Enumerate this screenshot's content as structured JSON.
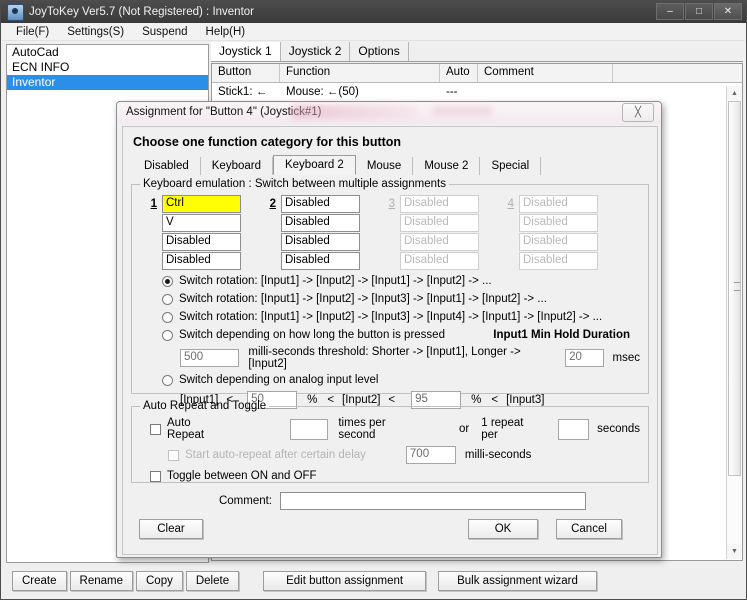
{
  "window": {
    "title": "JoyToKey Ver5.7 (Not Registered) : Inventor",
    "icon": "joystick-icon",
    "controls": {
      "minimize": "–",
      "maximize": "□",
      "close": "✕"
    }
  },
  "menubar": {
    "items": [
      "File(F)",
      "Settings(S)",
      "Suspend",
      "Help(H)"
    ]
  },
  "profiles": {
    "items": [
      {
        "label": "AutoCad",
        "selected": false
      },
      {
        "label": "ECN INFO",
        "selected": false
      },
      {
        "label": "Inventor",
        "selected": true
      }
    ]
  },
  "joystick_panel": {
    "tabs": [
      {
        "label": "Joystick 1",
        "active": true
      },
      {
        "label": "Joystick 2",
        "active": false
      },
      {
        "label": "Options",
        "active": false
      }
    ],
    "columns": [
      "Button",
      "Function",
      "Auto",
      "Comment"
    ],
    "rows": [
      {
        "button": "Stick1: ←",
        "function": "Mouse: ←(50)",
        "auto": "---",
        "comment": ""
      }
    ],
    "scrollbar": {
      "up": "▲",
      "down": "▼"
    }
  },
  "bottom_toolbar": {
    "buttons": [
      "Create",
      "Rename",
      "Copy",
      "Delete"
    ],
    "actions": [
      "Edit button assignment",
      "Bulk assignment wizard"
    ]
  },
  "dialog": {
    "title": "Assignment for \"Button 4\" (Joystick#1)",
    "close_glyph": "╳",
    "heading": "Choose one function category for this button",
    "category_tabs": [
      {
        "label": "Disabled",
        "active": false
      },
      {
        "label": "Keyboard",
        "active": false
      },
      {
        "label": "Keyboard 2",
        "active": true
      },
      {
        "label": "Mouse",
        "active": false
      },
      {
        "label": "Mouse 2",
        "active": false
      },
      {
        "label": "Special",
        "active": false
      }
    ],
    "keyboard_group": {
      "legend": "Keyboard emulation : Switch between multiple assignments",
      "columns": [
        {
          "number": "1",
          "enabled": true,
          "fields": [
            {
              "value": "Ctrl",
              "highlight": true
            },
            {
              "value": "V",
              "highlight": false
            },
            {
              "value": "Disabled",
              "highlight": false
            },
            {
              "value": "Disabled",
              "highlight": false
            }
          ]
        },
        {
          "number": "2",
          "enabled": true,
          "fields": [
            {
              "value": "Disabled",
              "highlight": false
            },
            {
              "value": "Disabled",
              "highlight": false
            },
            {
              "value": "Disabled",
              "highlight": false
            },
            {
              "value": "Disabled",
              "highlight": false
            }
          ]
        },
        {
          "number": "3",
          "enabled": false,
          "fields": [
            {
              "value": "Disabled",
              "highlight": false
            },
            {
              "value": "Disabled",
              "highlight": false
            },
            {
              "value": "Disabled",
              "highlight": false
            },
            {
              "value": "Disabled",
              "highlight": false
            }
          ]
        },
        {
          "number": "4",
          "enabled": false,
          "fields": [
            {
              "value": "Disabled",
              "highlight": false
            },
            {
              "value": "Disabled",
              "highlight": false
            },
            {
              "value": "Disabled",
              "highlight": false
            },
            {
              "value": "Disabled",
              "highlight": false
            }
          ]
        }
      ],
      "radios": [
        {
          "label": "Switch rotation: [Input1] -> [Input2] -> [Input1] -> [Input2] -> ...",
          "checked": true
        },
        {
          "label": "Switch rotation: [Input1] -> [Input2] -> [Input3] -> [Input1] -> [Input2] -> ...",
          "checked": false
        },
        {
          "label": "Switch rotation: [Input1] -> [Input2] -> [Input3] -> [Input4] -> [Input1] -> [Input2] -> ...",
          "checked": false
        },
        {
          "label": "Switch depending on how long the button is pressed",
          "checked": false
        },
        {
          "label": "Switch depending on analog input level",
          "checked": false
        }
      ],
      "hold_duration_label": "Input1 Min Hold Duration",
      "threshold_value": "500",
      "threshold_text": "milli-seconds threshold: Shorter -> [Input1], Longer -> [Input2]",
      "hold_value": "20",
      "hold_unit": "msec",
      "analog": {
        "input1_label": "[Input1]",
        "lt1": "<",
        "value1": "50",
        "pct1": "%",
        "lt2": "<",
        "input2_label": "[Input2]",
        "lt3": "<",
        "value2": "95",
        "pct2": "%",
        "lt4": "<",
        "input3_label": "[Input3]"
      }
    },
    "auto_repeat_group": {
      "legend": "Auto Repeat and Toggle",
      "auto_repeat": {
        "label": "Auto Repeat",
        "checked": false,
        "value": ""
      },
      "times_per_second": "times per second",
      "or_label": "or",
      "one_repeat_per": "1 repeat per",
      "seconds_value": "",
      "seconds_label": "seconds",
      "delay": {
        "label": "Start auto-repeat after certain delay",
        "checked": false,
        "enabled": false
      },
      "delay_value": "700",
      "delay_unit": "milli-seconds",
      "toggle": {
        "label": "Toggle between ON and OFF",
        "checked": false
      }
    },
    "comment": {
      "label": "Comment:",
      "value": "",
      "placeholder": ""
    },
    "buttons": {
      "clear": "Clear",
      "ok": "OK",
      "cancel": "Cancel"
    }
  }
}
